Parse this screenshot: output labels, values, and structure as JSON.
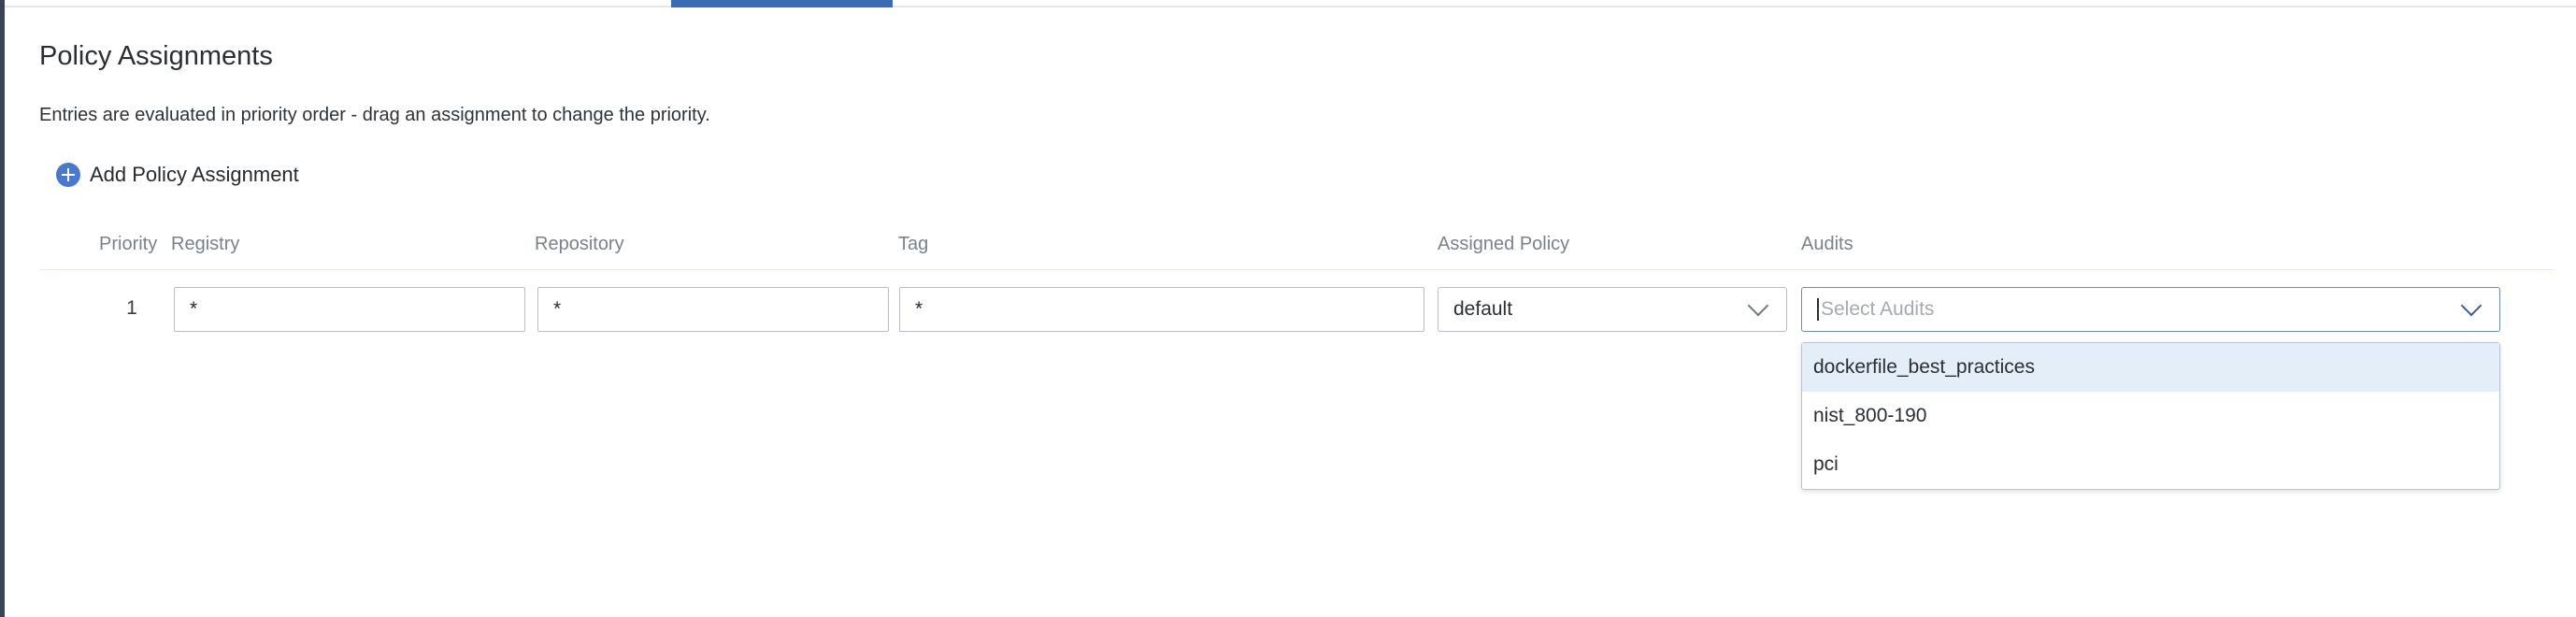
{
  "page": {
    "title": "Policy Assignments",
    "subtitle": "Entries are evaluated in priority order - drag an assignment to change the priority."
  },
  "actions": {
    "add_label": "Add Policy Assignment"
  },
  "table": {
    "headers": {
      "priority": "Priority",
      "registry": "Registry",
      "repository": "Repository",
      "tag": "Tag",
      "assigned_policy": "Assigned Policy",
      "audits": "Audits"
    },
    "rows": [
      {
        "priority": "1",
        "registry": "*",
        "repository": "*",
        "tag": "*",
        "assigned_policy": "default",
        "audits_placeholder": "Select Audits"
      }
    ]
  },
  "audits_dropdown": {
    "options": [
      "dockerfile_best_practices",
      "nist_800-190",
      "pci"
    ],
    "highlighted_index": 0
  },
  "colors": {
    "accent": "#3c6bb5",
    "add_icon": "#4a78cf",
    "highlight": "#e3eef9"
  },
  "icons": {
    "add": "plus-circle-icon",
    "select": "chevron-down-icon"
  }
}
